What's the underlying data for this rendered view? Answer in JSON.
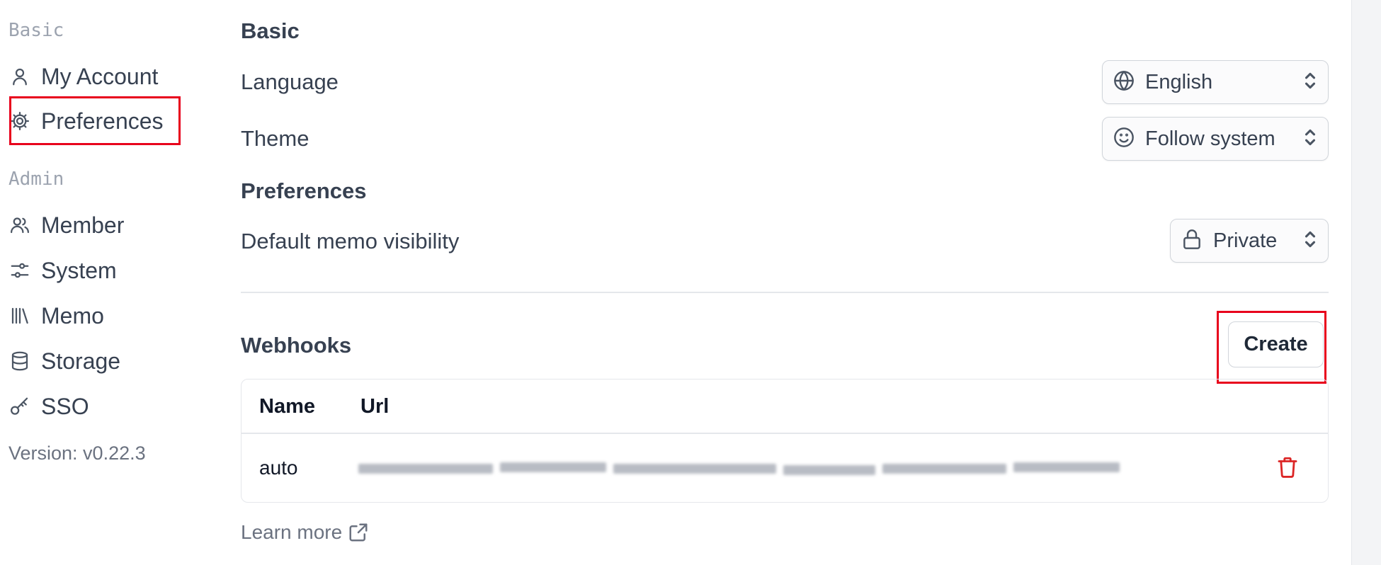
{
  "sidebar": {
    "basic_label": "Basic",
    "admin_label": "Admin",
    "items": [
      {
        "label": "My Account",
        "icon": "user-icon"
      },
      {
        "label": "Preferences",
        "icon": "gear-icon"
      },
      {
        "label": "Member",
        "icon": "users-icon"
      },
      {
        "label": "System",
        "icon": "sliders-icon"
      },
      {
        "label": "Memo",
        "icon": "library-icon"
      },
      {
        "label": "Storage",
        "icon": "database-icon"
      },
      {
        "label": "SSO",
        "icon": "key-icon"
      }
    ],
    "version": "Version: v0.22.3"
  },
  "main": {
    "basic_heading": "Basic",
    "language": {
      "label": "Language",
      "value": "English",
      "icon": "globe-icon"
    },
    "theme": {
      "label": "Theme",
      "value": "Follow system",
      "icon": "smile-icon"
    },
    "preferences_heading": "Preferences",
    "visibility": {
      "label": "Default memo visibility",
      "value": "Private",
      "icon": "lock-icon"
    },
    "webhooks": {
      "heading": "Webhooks",
      "create_label": "Create",
      "columns": [
        "Name",
        "Url"
      ],
      "rows": [
        {
          "name": "auto",
          "url_hidden": true
        }
      ]
    },
    "learn_more": "Learn more"
  },
  "colors": {
    "highlight": "#e8001c",
    "delete": "#dc2626",
    "muted": "#9ca3af"
  }
}
